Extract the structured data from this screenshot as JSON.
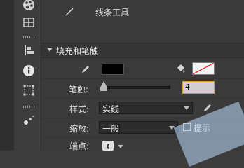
{
  "tools": {
    "line_tool_label": "线条工具"
  },
  "fill_stroke": {
    "section_title": "填充和笔触",
    "stroke_color": "#000000",
    "fill_state": "none",
    "stroke_label": "笔触:",
    "stroke_value": "4",
    "stroke_level": 0.04,
    "style_label": "样式:",
    "style_value": "实线",
    "scale_label": "缩放:",
    "scale_value": "一般",
    "hint_label": "提示",
    "hint_checked": false,
    "cap_label": "端点:"
  },
  "icons": {
    "toolbar": [
      "palette-icon",
      "grid-icon",
      "align-icon",
      "info-icon",
      "transform-icon",
      "motion-icon"
    ],
    "pencil": "pencil-icon",
    "paint_bucket": "paint-bucket-icon",
    "line": "line-tool-icon"
  }
}
